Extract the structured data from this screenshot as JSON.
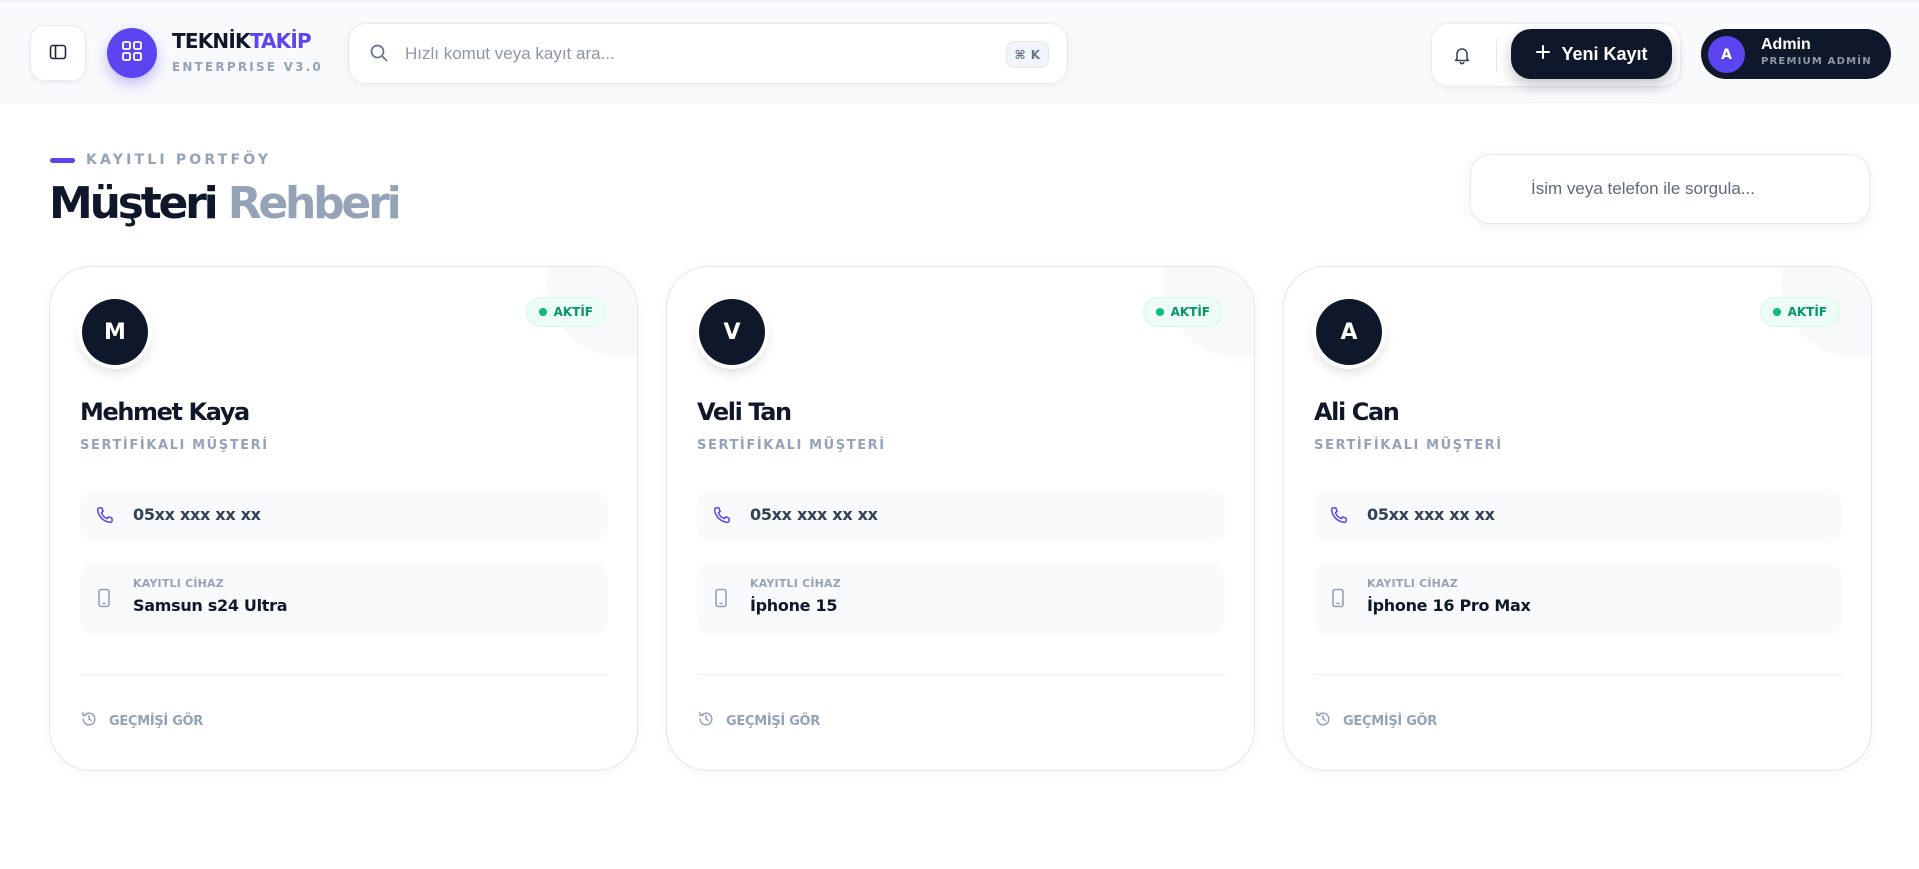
{
  "brand": {
    "name_part1": "TEKNİK",
    "name_part2": "TAKİP",
    "subtitle": "ENTERPRISE V3.0"
  },
  "command_search": {
    "placeholder": "Hızlı komut veya kayıt ara...",
    "shortcut_symbol": "⌘",
    "shortcut_key": "K"
  },
  "actions": {
    "new_record_label": "Yeni Kayıt"
  },
  "user": {
    "initial": "A",
    "name": "Admin",
    "role": "PREMIUM ADMİN"
  },
  "page": {
    "eyebrow": "KAYITLI PORTFÖY",
    "title_part1": "Müşteri",
    "title_part2": "Rehberi",
    "search_placeholder": "İsim veya telefon ile sorgula..."
  },
  "customers": [
    {
      "initial": "M",
      "status": "AKTİF",
      "name": "Mehmet Kaya",
      "type": "SERTİFİKALI MÜŞTERİ",
      "phone": "05xx xxx xx xx",
      "device_label": "KAYITLI CİHAZ",
      "device": "Samsun s24 Ultra",
      "history_label": "GEÇMİŞİ GÖR"
    },
    {
      "initial": "V",
      "status": "AKTİF",
      "name": "Veli Tan",
      "type": "SERTİFİKALI MÜŞTERİ",
      "phone": "05xx xxx xx xx",
      "device_label": "KAYITLI CİHAZ",
      "device": "İphone 15",
      "history_label": "GEÇMİŞİ GÖR"
    },
    {
      "initial": "A",
      "status": "AKTİF",
      "name": "Ali Can",
      "type": "SERTİFİKALI MÜŞTERİ",
      "phone": "05xx xxx xx xx",
      "device_label": "KAYITLI CİHAZ",
      "device": "İphone 16 Pro Max",
      "history_label": "GEÇMİŞİ GÖR"
    }
  ],
  "icons": {
    "sidebar_toggle": "sidebar-panel-icon",
    "logo": "grid-icon",
    "search": "search-icon",
    "notifications": "bell-icon",
    "add": "plus-icon",
    "phone": "phone-icon",
    "device": "smartphone-icon",
    "history": "history-icon"
  },
  "colors": {
    "accent": "#5b45f0",
    "dark": "#0f172a",
    "muted": "#94a3b8",
    "status_active": "#10b981"
  }
}
